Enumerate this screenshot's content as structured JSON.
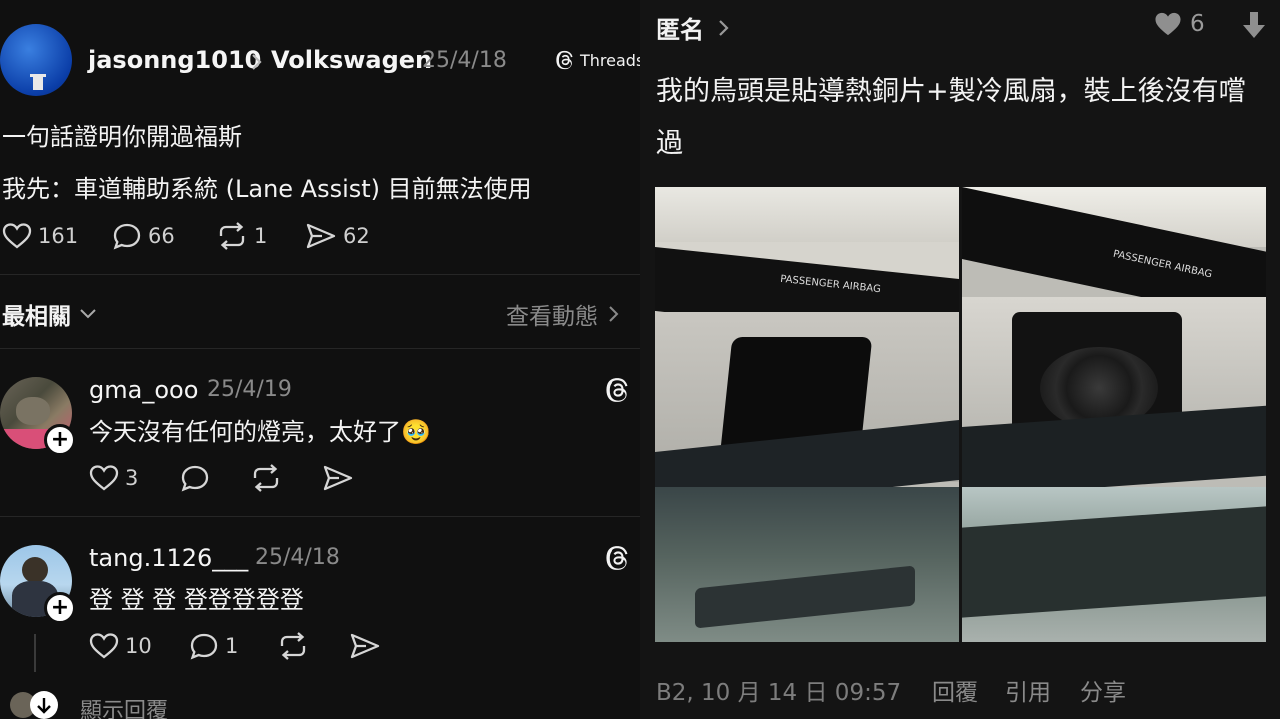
{
  "post": {
    "username": "jasonng1010",
    "topic": "Volkswagen",
    "date": "25/4/18",
    "app_label": "Threads",
    "line1": "一句話證明你開過福斯",
    "line2": "我先：車道輔助系統 (Lane Assist) 目前無法使用",
    "likes": "161",
    "comments": "66",
    "reposts": "1",
    "shares": "62"
  },
  "sort": {
    "label": "最相關",
    "activity": "查看動態"
  },
  "replies": [
    {
      "username": "gma_ooo",
      "date": "25/4/19",
      "text": "今天沒有任何的燈亮，太好了🥹",
      "likes": "3",
      "comments": "",
      "reposts": "",
      "shares": ""
    },
    {
      "username": "tang.1126___",
      "date": "25/4/18",
      "text": "登 登 登 登登登登登",
      "likes": "10",
      "comments": "1",
      "reposts": "",
      "shares": ""
    }
  ],
  "show_replies": "顯示回覆",
  "forum": {
    "author": "匿名",
    "like_count": "6",
    "text": "我的鳥頭是貼導熱銅片+製冷風扇，裝上後沒有嚐過",
    "photo_label_left": "PASSENGER AIRBAG",
    "photo_label_right": "PASSENGER AIRBAG",
    "meta": "B2, 10 月 14 日 09:57",
    "reply": "回覆",
    "quote": "引用",
    "share": "分享"
  },
  "colors": {
    "left_bg": "#101010",
    "right_bg": "#141414",
    "muted": "#8a8a8a"
  },
  "icons": [
    "heart-icon",
    "comment-icon",
    "repost-icon",
    "share-icon",
    "threads-logo-icon",
    "chevron-down-icon",
    "chevron-right-icon",
    "downvote-icon"
  ]
}
